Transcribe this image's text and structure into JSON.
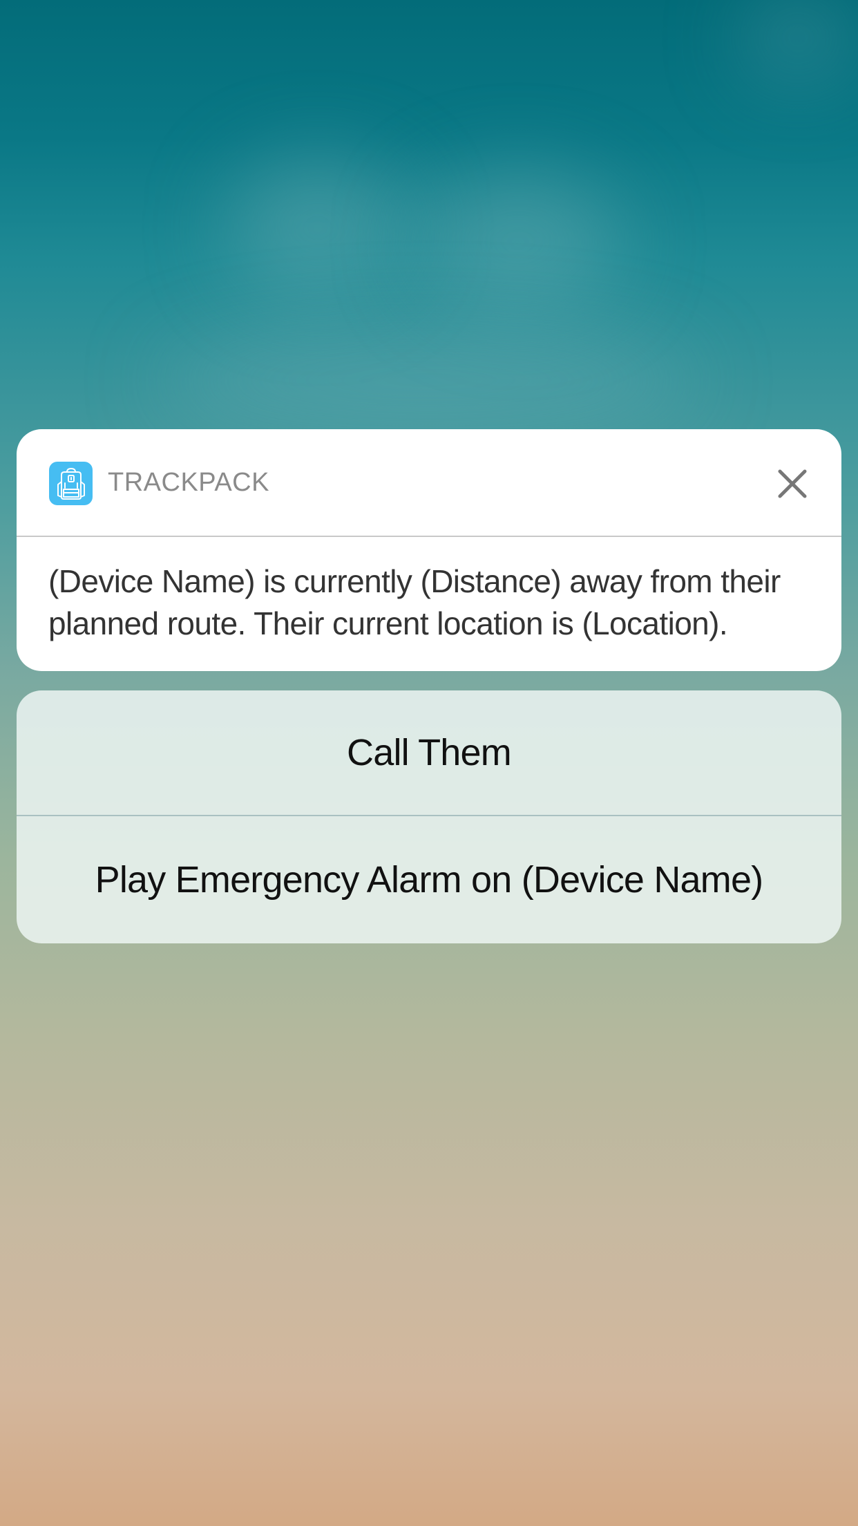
{
  "notification": {
    "app_icon": "backpack-icon",
    "app_name": "TRACKPACK",
    "close_icon": "close-icon",
    "message": "(Device Name) is currently (Distance) away from their planned route. Their current location is (Location)."
  },
  "actions": {
    "call": "Call Them",
    "alarm": "Play Emergency Alarm on (Device Name)"
  },
  "colors": {
    "app_icon_bg": "#46bdf2",
    "card_bg": "#ffffff",
    "actions_bg": "#dfe9e8"
  }
}
